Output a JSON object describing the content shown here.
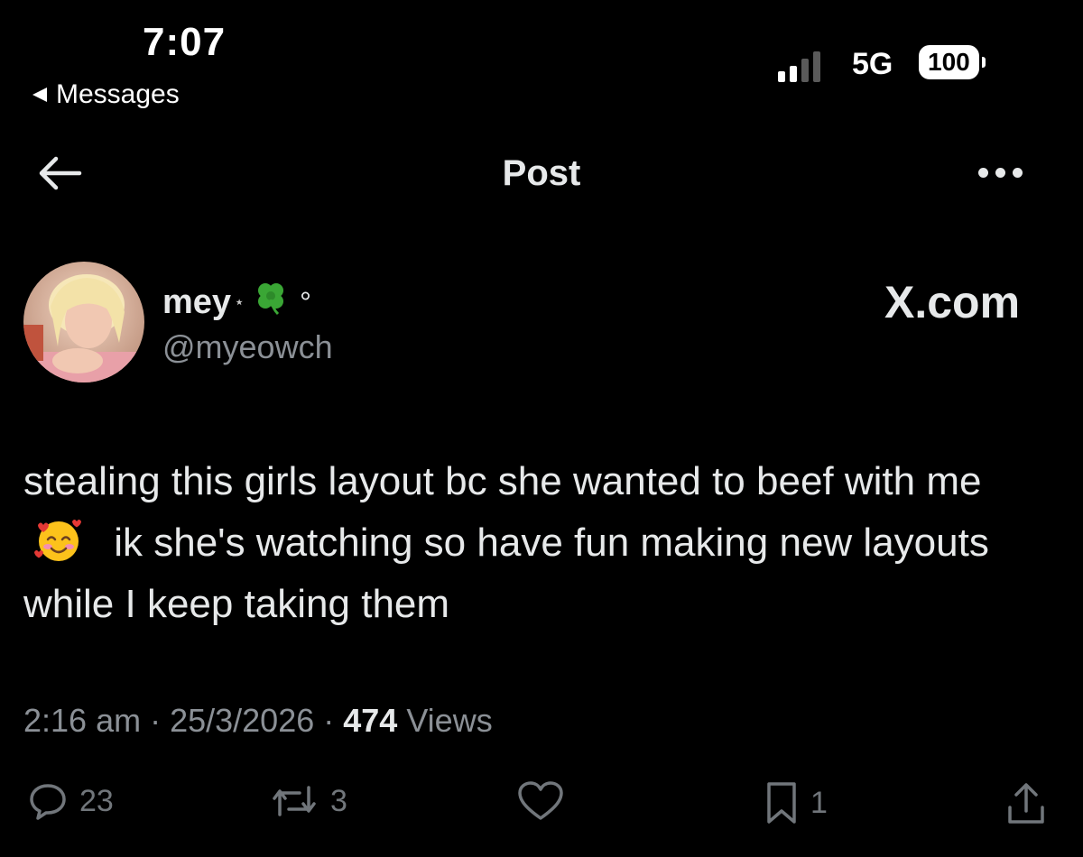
{
  "status_bar": {
    "time": "7:07",
    "back_label": "Messages",
    "network": "5G",
    "battery": "100"
  },
  "header": {
    "title": "Post"
  },
  "author": {
    "display_name": "mey",
    "name_star": "⋆",
    "name_decoration": "°",
    "handle": "@myeowch"
  },
  "source_label": "X.com",
  "post": {
    "text_part1": "stealing this girls layout bc she wanted to beef with me",
    "text_part2": "ik she's watching so have fun making new layouts while I keep taking them"
  },
  "meta": {
    "time": "2:16 am",
    "separator": " · ",
    "date": "25/3/2026",
    "views_count": "474",
    "views_label": " Views"
  },
  "actions": {
    "replies": "23",
    "reposts": "3",
    "bookmarks": "1"
  },
  "colors": {
    "background": "#000000",
    "text_primary": "#e7e9ea",
    "text_secondary": "#8b9096",
    "icon": "#71767b"
  },
  "icons": {
    "back": "arrow-left-icon",
    "more": "more-horizontal-icon",
    "reply": "speech-bubble-icon",
    "repost": "repost-arrows-icon",
    "like": "heart-icon",
    "bookmark": "bookmark-icon",
    "share": "share-icon"
  }
}
